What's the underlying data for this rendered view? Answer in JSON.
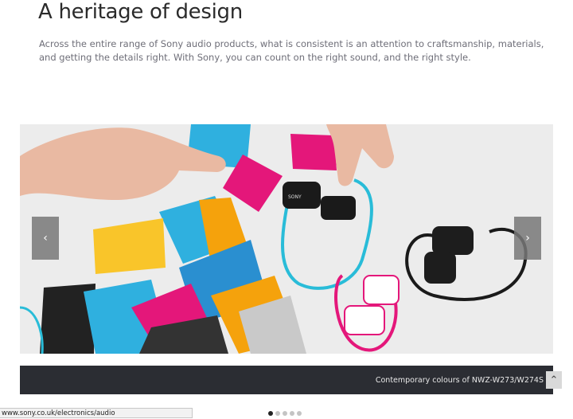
{
  "header": {
    "title": "A heritage of design",
    "intro": "Across the entire range of Sony audio products, what is consistent is an attention to craftsmanship, materials, and getting the details right. With Sony, you can count on the right sound, and the right style."
  },
  "carousel": {
    "prev_label": "‹",
    "next_label": "›",
    "caption": "Contemporary colours of NWZ-W273/W274S",
    "slide_count": 5,
    "active_slide": 1,
    "product_brand_text": "SONY"
  },
  "back_to_top": {
    "label": "⌃"
  },
  "status_bar": {
    "url": "www.sony.co.uk/electronics/audio"
  },
  "colors": {
    "caption_bar": "#2b2d33",
    "cyan": "#29a9d8",
    "magenta": "#e4177a",
    "orange": "#f5a20c",
    "yellow": "#f9c52a",
    "black_card": "#222222",
    "skin": "#e9b9a2"
  }
}
